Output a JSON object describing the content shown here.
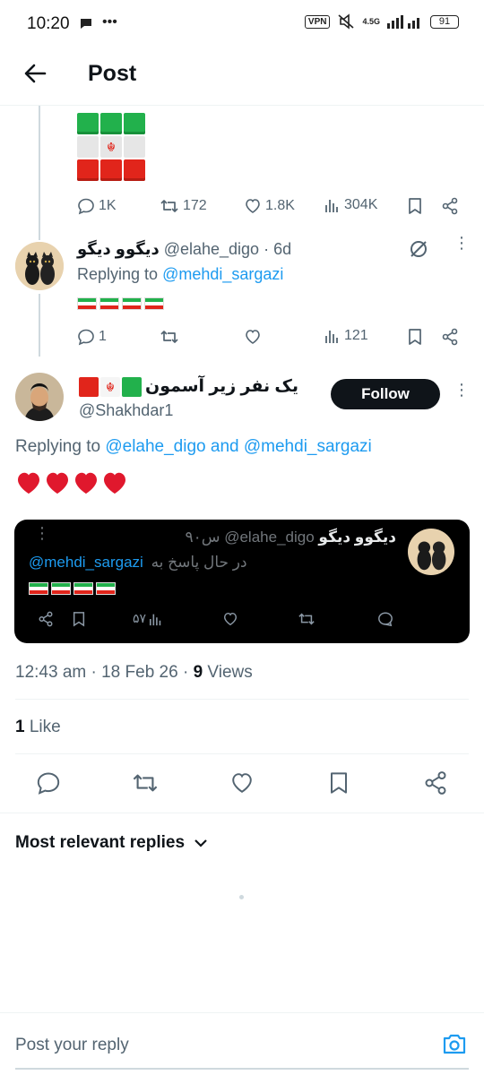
{
  "status_bar": {
    "time": "10:20",
    "network": "4.5G",
    "vpn": "VPN",
    "battery": "91"
  },
  "header": {
    "title": "Post"
  },
  "tweet1": {
    "stats": {
      "replies": "1K",
      "retweets": "172",
      "likes": "1.8K",
      "views": "304K"
    }
  },
  "tweet2": {
    "name": "دیگوو دیگو",
    "handle": "@elahe_digo",
    "time": "· 6d",
    "replying_prefix": "Replying to ",
    "replying_to": "@mehdi_sargazi",
    "stats": {
      "replies": "1",
      "retweets": "",
      "likes": "",
      "views": "121"
    }
  },
  "main_tweet": {
    "name": "یک نفر زیر آسمون",
    "handle": "@Shakhdar1",
    "follow_label": "Follow",
    "replying_prefix": "Replying to ",
    "replying_to_1": "@elahe_digo",
    "replying_and": " and ",
    "replying_to_2": "@mehdi_sargazi",
    "body_emoji": "❤️❤️❤️❤️",
    "embedded": {
      "name": "دیگوو دیگو",
      "handle": "@elahe_digo",
      "time": "۹۰س",
      "replying_text": "در حال پاسخ به",
      "replying_to": "@mehdi_sargazi",
      "views": "۵۷"
    },
    "timestamp": "12:43 am · 18 Feb 26 · ",
    "views_count": "9",
    "views_label": " Views",
    "likes_count": "1",
    "likes_label": " Like"
  },
  "replies": {
    "sort_label": "Most relevant replies"
  },
  "composer": {
    "placeholder": "Post your reply"
  }
}
